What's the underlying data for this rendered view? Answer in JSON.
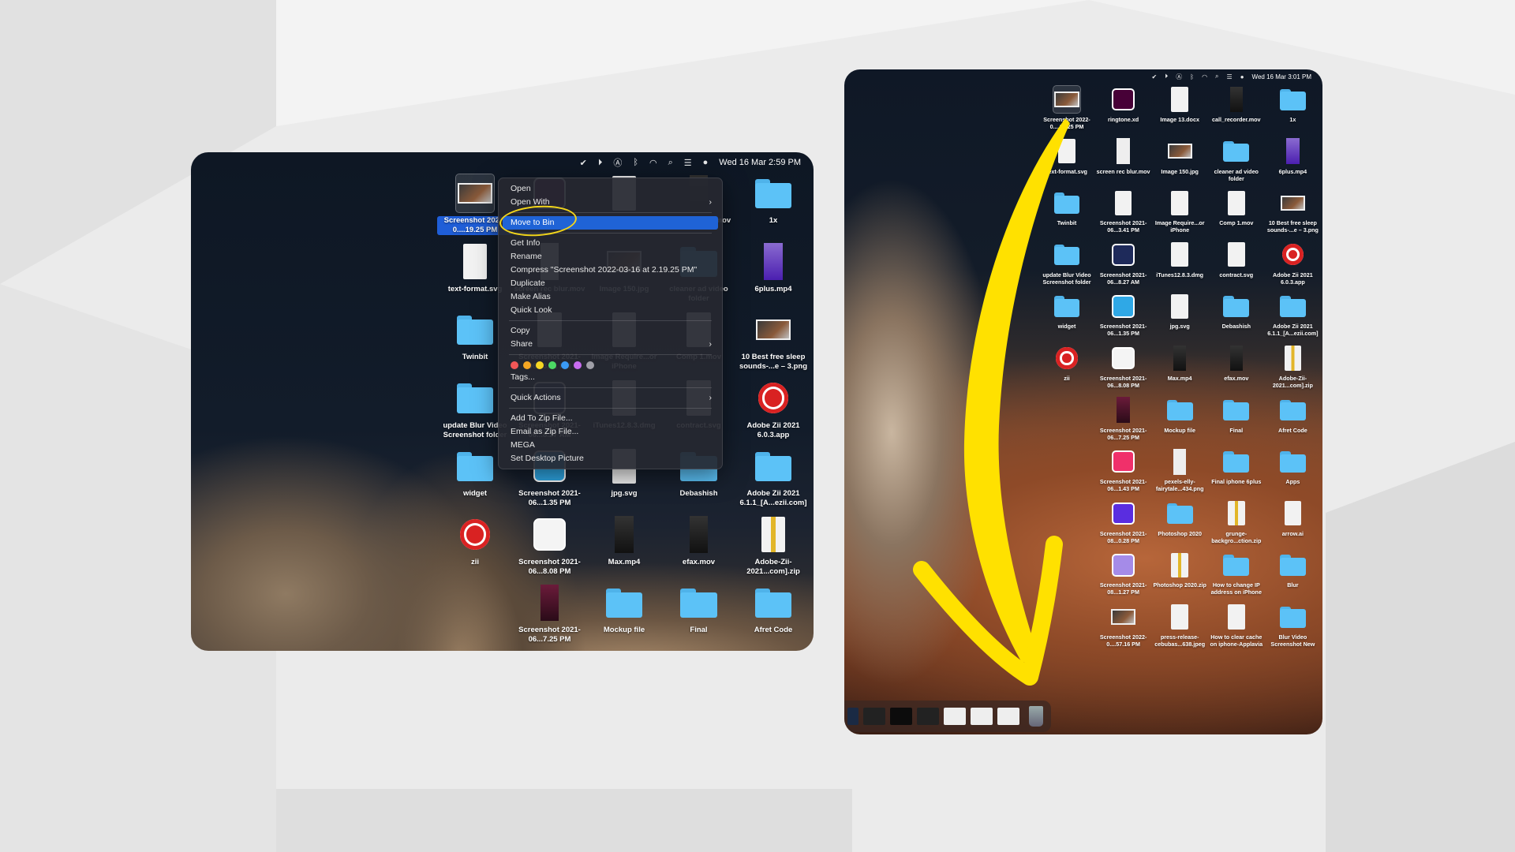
{
  "colors": {
    "background": "#ebebeb",
    "selection": "#1f63d6",
    "highlight_ellipse": "#f2d51b",
    "arrow": "#ffe100",
    "folder": "#5cc2f7"
  },
  "left_screen": {
    "menubar": {
      "icons": [
        "checkmark-icon",
        "play-icon",
        "input-a-icon",
        "bluetooth-icon",
        "wifi-icon",
        "search-icon",
        "control-center-icon",
        "siri-icon"
      ],
      "clock": "Wed 16 Mar  2:59 PM"
    },
    "context_menu": {
      "groups": [
        [
          {
            "label": "Open"
          },
          {
            "label": "Open With",
            "submenu": true
          }
        ],
        [
          {
            "label": "Move to Bin",
            "highlighted": true
          }
        ],
        [
          {
            "label": "Get Info"
          },
          {
            "label": "Rename"
          },
          {
            "label": "Compress \"Screenshot 2022-03-16 at 2.19.25 PM\""
          },
          {
            "label": "Duplicate"
          },
          {
            "label": "Make Alias"
          },
          {
            "label": "Quick Look"
          }
        ],
        [
          {
            "label": "Copy"
          },
          {
            "label": "Share",
            "submenu": true
          }
        ],
        [
          {
            "tags": true
          },
          {
            "label": "Tags..."
          }
        ],
        [
          {
            "label": "Quick Actions",
            "submenu": true
          }
        ],
        [
          {
            "label": "Add To Zip File..."
          },
          {
            "label": "Email as Zip File..."
          },
          {
            "label": "MEGA"
          },
          {
            "label": "Set Desktop Picture"
          }
        ]
      ],
      "tag_colors": [
        "#f25757",
        "#f5a623",
        "#f5d623",
        "#4cd964",
        "#3a9af5",
        "#c86cf0",
        "#a0a0a8"
      ],
      "submenu_chevron": "›"
    }
  },
  "right_screen": {
    "menubar": {
      "icons": [
        "checkmark-icon",
        "play-icon",
        "input-a-icon",
        "bluetooth-icon",
        "wifi-icon",
        "search-icon",
        "control-center-icon",
        "siri-icon"
      ],
      "clock": "Wed 16 Mar  3:01 PM"
    },
    "dock": [
      "photoshop-window",
      "finder-window",
      "skype-window",
      "finder-window",
      "notes-window",
      "chrome-window",
      "xd-window",
      "trash-icon"
    ]
  },
  "desktop_items": [
    [
      {
        "label": "Screenshot 2022-0....19.25 PM",
        "icon": "image",
        "selected": true
      },
      {
        "label": "ringtone.xd",
        "icon": "app",
        "color": "#470137"
      },
      {
        "label": "Image 13.docx",
        "icon": "file"
      },
      {
        "label": "call_recorder.mov",
        "icon": "video"
      },
      {
        "label": "1x",
        "icon": "folder"
      }
    ],
    [
      {
        "label": "text-format.svg",
        "icon": "file"
      },
      {
        "label": "screen rec blur.mov",
        "icon": "video light"
      },
      {
        "label": "Image 150.jpg",
        "icon": "image"
      },
      {
        "label": "cleaner ad video folder",
        "icon": "folder"
      },
      {
        "label": "6plus.mp4",
        "icon": "video purple"
      }
    ],
    [
      {
        "label": "Twinbit",
        "icon": "folder"
      },
      {
        "label": "Screenshot 2021-06...3.41 PM",
        "icon": "file"
      },
      {
        "label": "Image Require...or iPhone",
        "icon": "file"
      },
      {
        "label": "Comp 1.mov",
        "icon": "file"
      },
      {
        "label": "10 Best free sleep sounds-...e – 3.png",
        "icon": "image"
      }
    ],
    [
      {
        "label": "update Blur Video Screenshot folder",
        "icon": "folder"
      },
      {
        "label": "Screenshot 2021-06...8.27 AM",
        "icon": "app",
        "color": "#1e2a5a"
      },
      {
        "label": "iTunes12.8.3.dmg",
        "icon": "file"
      },
      {
        "label": "contract.svg",
        "icon": "file"
      },
      {
        "label": "Adobe Zii 2021 6.0.3.app",
        "icon": "cc"
      }
    ],
    [
      {
        "label": "widget",
        "icon": "folder"
      },
      {
        "label": "Screenshot 2021-06...1.35 PM",
        "icon": "app",
        "color": "#2fa8e6"
      },
      {
        "label": "jpg.svg",
        "icon": "file"
      },
      {
        "label": "Debashish",
        "icon": "folder"
      },
      {
        "label": "Adobe Zii 2021 6.1.1_[A...ezii.com]",
        "icon": "folder"
      }
    ],
    [
      {
        "label": "zii",
        "icon": "cc"
      },
      {
        "label": "Screenshot 2021-06...8.08 PM",
        "icon": "app",
        "color": "#f4f4f4"
      },
      {
        "label": "Max.mp4",
        "icon": "video"
      },
      {
        "label": "efax.mov",
        "icon": "video"
      },
      {
        "label": "Adobe-Zii-2021...com].zip",
        "icon": "zip"
      }
    ],
    [
      null,
      {
        "label": "Screenshot 2021-06...7.25 PM",
        "icon": "video maroon"
      },
      {
        "label": "Mockup file",
        "icon": "folder"
      },
      {
        "label": "Final",
        "icon": "folder"
      },
      {
        "label": "Afret Code",
        "icon": "folder"
      }
    ],
    [
      null,
      {
        "label": "Screenshot 2021-06...1.43 PM",
        "icon": "app",
        "color": "#f0306a"
      },
      {
        "label": "pexels-elly-fairytale...434.png",
        "icon": "video light"
      },
      {
        "label": "Final iphone 6plus",
        "icon": "folder"
      },
      {
        "label": "Apps",
        "icon": "folder"
      }
    ],
    [
      null,
      {
        "label": "Screenshot 2021-08...0.28 PM",
        "icon": "app",
        "color": "#5a2de0"
      },
      {
        "label": "Photoshop 2020",
        "icon": "folder"
      },
      {
        "label": "grunge-backgro...ction.zip",
        "icon": "zip"
      },
      {
        "label": "arrow.ai",
        "icon": "file"
      }
    ],
    [
      null,
      {
        "label": "Screenshot 2021-08...1.27 PM",
        "icon": "app",
        "color": "#a58be8"
      },
      {
        "label": "Photoshop 2020.zip",
        "icon": "zip"
      },
      {
        "label": "How to change IP address on iPhone",
        "icon": "folder"
      },
      {
        "label": "Blur",
        "icon": "folder"
      }
    ],
    [
      null,
      {
        "label": "Screenshot 2022-0....57.16 PM",
        "icon": "image"
      },
      {
        "label": "press-release-cebubas...638.jpeg",
        "icon": "file"
      },
      {
        "label": "How to clear cache on iphone-Applavia",
        "icon": "file"
      },
      {
        "label": "Blur Video Screenshot New",
        "icon": "folder"
      }
    ]
  ]
}
